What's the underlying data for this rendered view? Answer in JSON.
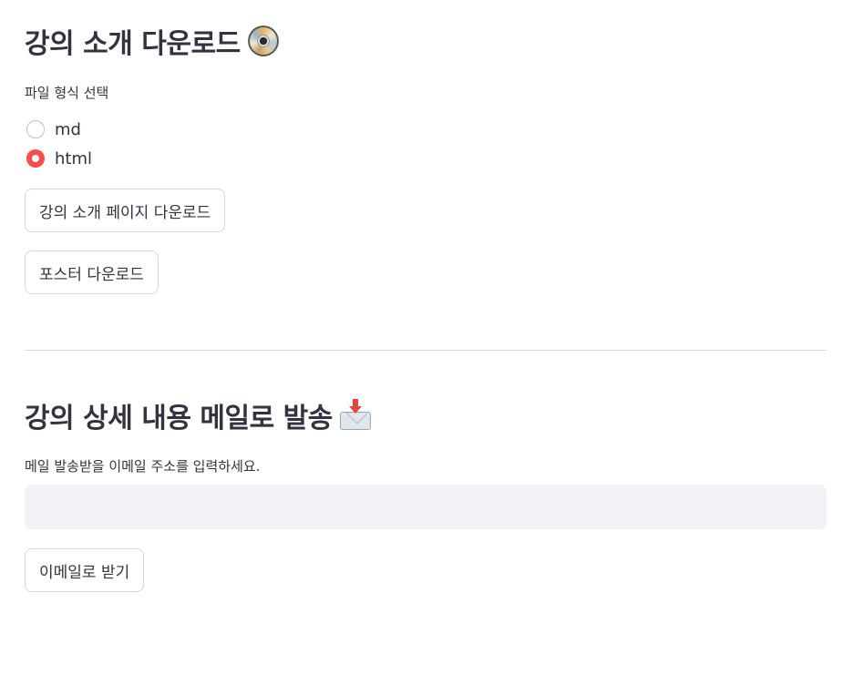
{
  "download_section": {
    "title": "강의 소개 다운로드",
    "title_icon": "optical-disc-icon",
    "format_label": "파일 형식 선택",
    "format_options": [
      {
        "label": "md",
        "selected": false
      },
      {
        "label": "html",
        "selected": true
      }
    ],
    "intro_button_label": "강의 소개 페이지 다운로드",
    "poster_button_label": "포스터 다운로드"
  },
  "email_section": {
    "title": "강의 상세 내용 메일로 발송",
    "title_icon": "envelope-with-arrow-icon",
    "email_label": "메일 발송받을 이메일 주소를 입력하세요.",
    "email_value": "",
    "email_placeholder": "",
    "send_button_label": "이메일로 받기"
  },
  "colors": {
    "accent": "#ff4b4b",
    "text": "#31333f",
    "input_bg": "#f0f2f6",
    "border": "#d6d7db"
  }
}
